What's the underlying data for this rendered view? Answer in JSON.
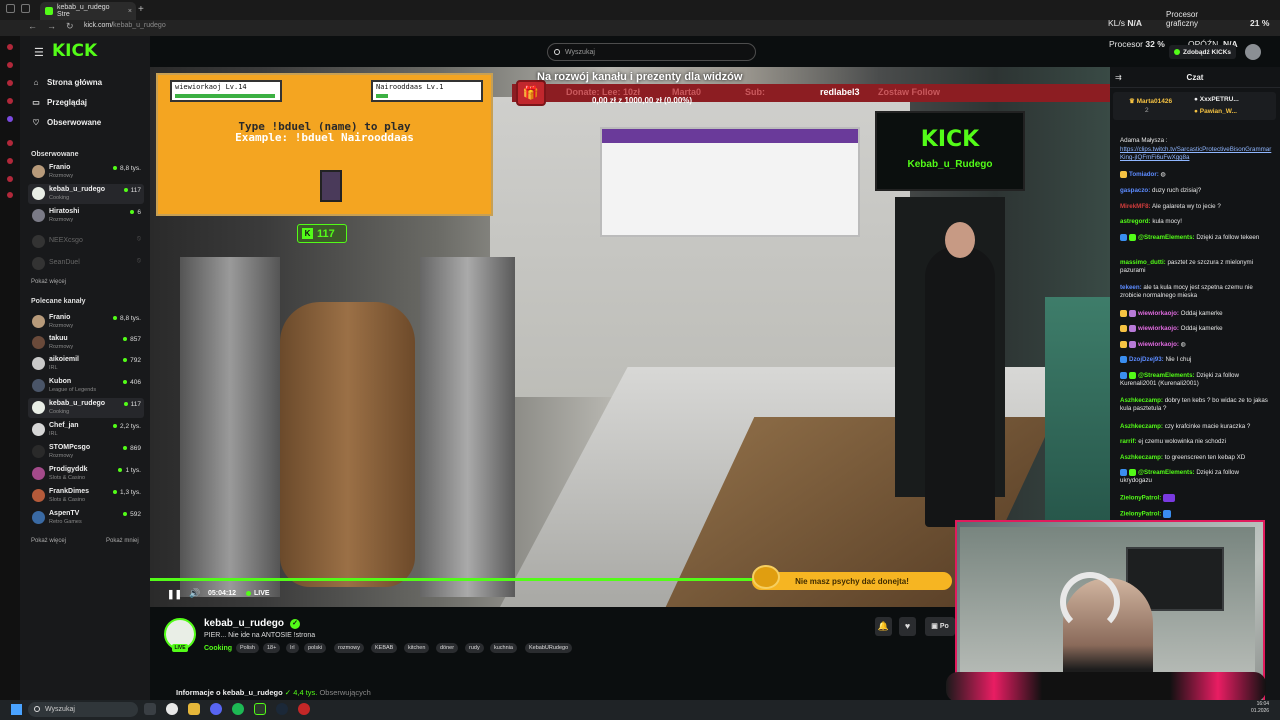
{
  "browser": {
    "tab_title": "kebab_u_rudego Stre",
    "new_tab": "+",
    "url_domain": "kick.com/",
    "url_path": "kebab_u_rudego"
  },
  "sidebar": {
    "logo": "KICK",
    "nav": [
      {
        "label": "Strona główna",
        "icon": "home-icon"
      },
      {
        "label": "Przeglądaj",
        "icon": "browse-icon"
      },
      {
        "label": "Obserwowane",
        "icon": "heart-icon"
      }
    ],
    "followed_header": "Obserwowane",
    "followed": [
      {
        "name": "Franio",
        "category": "Rozmowy",
        "viewers": "8,8 tys.",
        "live": true
      },
      {
        "name": "kebab_u_rudego",
        "category": "Cooking",
        "viewers": "117",
        "live": true,
        "active": true
      },
      {
        "name": "Hiratoshi",
        "category": "Rozmowy",
        "viewers": "6",
        "live": true
      },
      {
        "name": "NEEXcsgo",
        "category": "",
        "viewers": "",
        "live": false
      },
      {
        "name": "SeanDuel",
        "category": "",
        "viewers": "",
        "live": false
      }
    ],
    "recommended_header": "Polecane kanały",
    "recommended": [
      {
        "name": "Franio",
        "category": "Rozmowy",
        "viewers": "8,8 tys."
      },
      {
        "name": "takuu",
        "category": "Rozmowy",
        "viewers": "857"
      },
      {
        "name": "aikoiemil",
        "category": "IRL",
        "viewers": "792"
      },
      {
        "name": "Kubon",
        "category": "League of Legends",
        "viewers": "406"
      },
      {
        "name": "kebab_u_rudego",
        "category": "Cooking",
        "viewers": "117",
        "active": true
      },
      {
        "name": "Chef_jan",
        "category": "IRL",
        "viewers": "2,2 tys."
      },
      {
        "name": "STOMPcsgo",
        "category": "Rozmowy",
        "viewers": "869"
      },
      {
        "name": "Prodigyddk",
        "category": "Slots & Casino",
        "viewers": "1 tys."
      },
      {
        "name": "FrankDimes",
        "category": "Slots & Casino",
        "viewers": "1,3 tys."
      },
      {
        "name": "AspenTV",
        "category": "Retro Games",
        "viewers": "592"
      }
    ],
    "show_more": "Pokaż więcej",
    "show_less": "Pokaż mniej",
    "followed_show_more": "Pokaż więcej"
  },
  "topbar": {
    "search_placeholder": "Wyszukaj",
    "kicks_button": "Zdobądź KICKs"
  },
  "stats_overlay": {
    "kls_label": "KL/s",
    "kls_value": "N/A",
    "gpu_label": "Procesor graficzny",
    "gpu_value": "21 %",
    "cpu_label": "Procesor",
    "cpu_value": "32 %",
    "latency_label": "OPÓŹN.",
    "latency_value": "N/A"
  },
  "stream": {
    "game": {
      "player1": "wiewiorkaoj Lv.14",
      "player2": "Nairooddaas Lv.1",
      "line1": "Type !bduel (name) to play",
      "line2": "Example: !bduel Nairooddaas"
    },
    "kick_counter": "117",
    "kick_screen_title": "KICK",
    "kick_screen_sub": "Kebab_u_Rudego",
    "banner_title": "Na rozwój kanału i prezenty dla widzów",
    "banner_donate": "Donate: Lee: 10zł",
    "banner_name": "Marta0",
    "banner_sub": "Sub:",
    "banner_follow_name": "redlabel3",
    "banner_follow": "Zostaw Follow",
    "banner_progress": "0,00 zł z 1000,00 zł (0.00%)",
    "donate_message": "Nie masz psychy dać donejta!"
  },
  "player": {
    "pause_icon": "❚❚",
    "volume_icon": "🔊",
    "time": "05:04:12",
    "live_label": "LIVE",
    "progress": 1.0
  },
  "channel": {
    "name": "kebab_u_rudego",
    "live_badge": "LIVE",
    "title": "PIER... Nie ide na ANTOSIE !strona",
    "category": "Cooking",
    "tags": [
      "Polish",
      "18+",
      "Irl",
      "polski",
      "rozmowy",
      "KEBAB",
      "kitchen",
      "döner",
      "rudy",
      "kuchnia",
      "KebabURudego"
    ],
    "action_truncated": "Po",
    "about": "Informacje o kebab_u_rudego",
    "followers_value": "4,4 tys.",
    "followers_label": "Obserwujących"
  },
  "chat": {
    "title": "Czat",
    "pinned": [
      {
        "name": "Marta01426",
        "sub": "2"
      },
      {
        "name": "XxxPETRU...",
        "sub": "1"
      },
      {
        "name": "Pawian_W...",
        "sub": "1"
      }
    ],
    "messages": [
      {
        "user": "",
        "text": "Adama Małysza :",
        "color": "#e8e8e8"
      },
      {
        "user": "",
        "text": "https://clips.twitch.tv/SarcasticProtectiveBisonGrammarKing-jIQFmFi6uFwXgg8a",
        "color": "#8fb6ff",
        "link": true
      },
      {
        "user": "Tomiador:",
        "text": "",
        "color": "#5c8bff"
      },
      {
        "user": "gaspaczo:",
        "text": "duzy ruch dzisiaj?",
        "color": "#5c8bff"
      },
      {
        "user": "MirekMF8:",
        "text": "Ale galareta wy to jecie ?",
        "color": "#d23c3c"
      },
      {
        "user": "astregord:",
        "text": "kula mocy!",
        "color": "#53fc18"
      },
      {
        "user": "@StreamElements:",
        "text": "Dzięki za follow tekeen",
        "color": "#53fc18"
      },
      {
        "user": "massimo_dutti:",
        "text": "pasztet ze szczura z mielonymi pazurami",
        "color": "#53fc18"
      },
      {
        "user": "tekeen:",
        "text": "ale ta kula mocy jest szpetna czemu nie zrobicie normalnego mieska",
        "color": "#5c8bff"
      },
      {
        "user": "wiewiorkaojo:",
        "text": "Oddaj kamerke",
        "color": "#e06be0"
      },
      {
        "user": "wiewiorkaojo:",
        "text": "Oddaj kamerke",
        "color": "#e06be0"
      },
      {
        "user": "wiewiorkaojo:",
        "text": "",
        "color": "#e06be0"
      },
      {
        "user": "DzojDzej93:",
        "text": "Nie I chuj",
        "color": "#5c8bff"
      },
      {
        "user": "@StreamElements:",
        "text": "Dzięki za follow Kurenali2001 (Kurenali2001)",
        "color": "#53fc18"
      },
      {
        "user": "Aszhkeczamp:",
        "text": "dobry ten kebs ? bo widac ze to jakas kula pasztetula ?",
        "color": "#53fc18"
      },
      {
        "user": "Aszhkeczamp:",
        "text": "czy krafcinke macie kuraczka ?",
        "color": "#53fc18"
      },
      {
        "user": "rarrif:",
        "text": "ej czemu wolowinka nie schodzi",
        "color": "#53fc18"
      },
      {
        "user": "Aszhkeczamp:",
        "text": "to greenscreen ten kebap XD",
        "color": "#53fc18"
      },
      {
        "user": "@StreamElements:",
        "text": "Dzięki za follow ukrydogazu",
        "color": "#53fc18"
      },
      {
        "user": "ZielonyPatrol:",
        "text": "",
        "color": "#53fc18"
      },
      {
        "user": "ZielonyPatrol:",
        "text": "",
        "color": "#53fc18"
      }
    ]
  },
  "taskbar": {
    "search_placeholder": "Wyszukaj",
    "clock_time": "16:04",
    "clock_date": "01.2026"
  },
  "colors": {
    "kick_green": "#53fc18",
    "banner_red": "#8c1d22",
    "game_orange": "#f4a521",
    "cam_border": "#e01b5d"
  }
}
